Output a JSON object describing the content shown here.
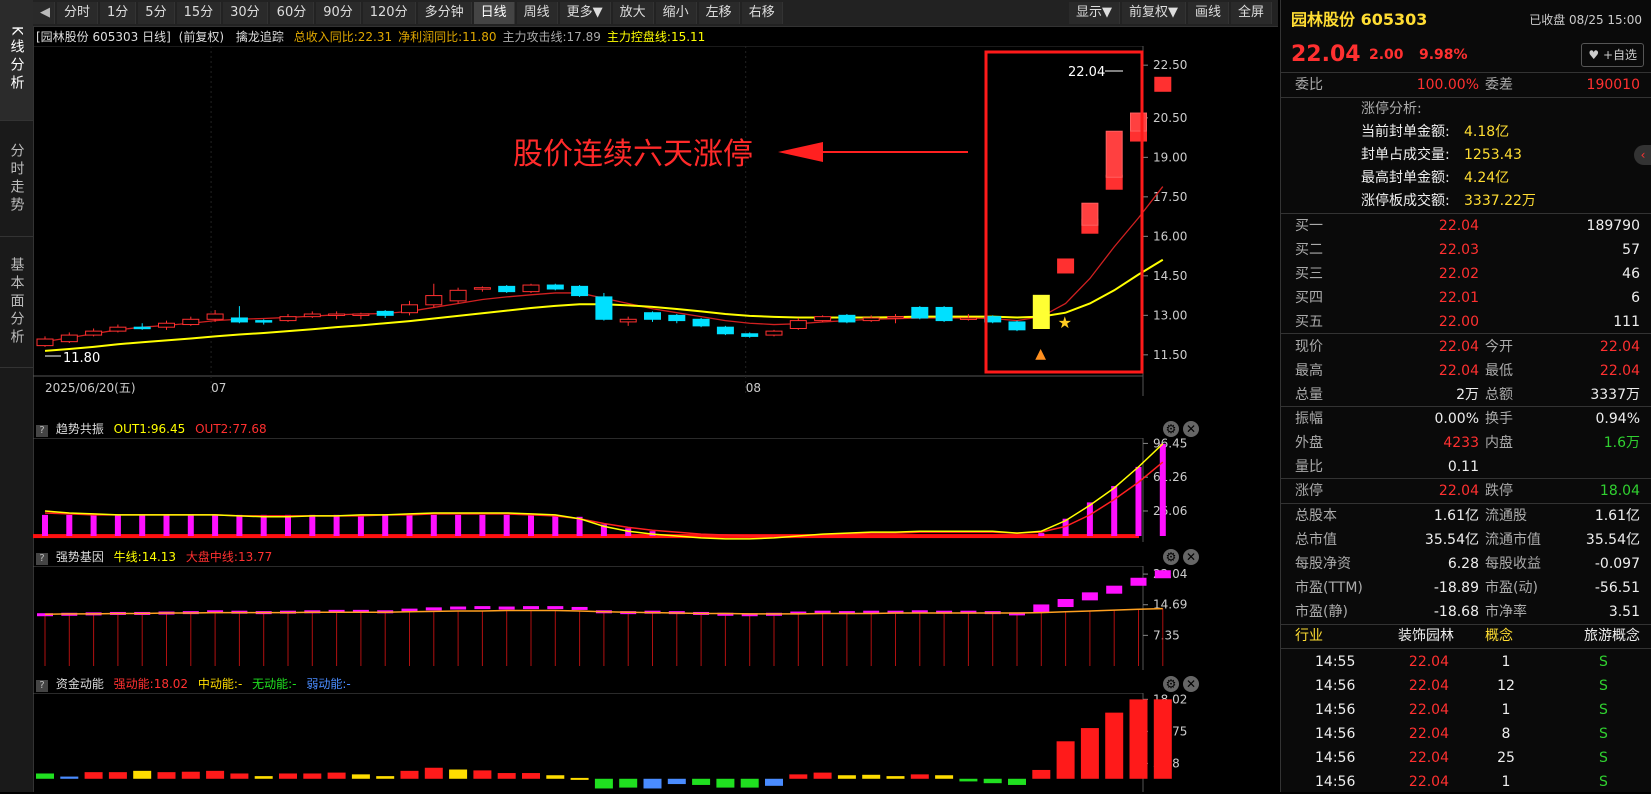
{
  "rail": {
    "tabs": [
      {
        "label": "K线分析",
        "active": true
      },
      {
        "label": "分时走势",
        "active": false
      },
      {
        "label": "基本面分析",
        "active": false
      }
    ]
  },
  "toolbar": {
    "back_icon": "back-arrow-icon",
    "buttons": [
      "分时",
      "1分",
      "5分",
      "15分",
      "30分",
      "60分",
      "90分",
      "120分",
      "多分钟",
      "日线",
      "周线",
      "更多▼",
      "放大",
      "缩小",
      "左移",
      "右移"
    ],
    "active": "日线",
    "right_buttons": [
      "显示▼",
      "前复权▼",
      "画线",
      "全屏"
    ]
  },
  "main_chart": {
    "header_prefix": "[园林股份 605303 日线]",
    "header_adjust": "(前复权)",
    "header_indicator": "擒龙追踪",
    "stats": [
      {
        "label": "总收入同比:22.31",
        "color": "#e0a800"
      },
      {
        "label": "净利润同比:11.80",
        "color": "#e0a800"
      },
      {
        "label": "主力攻击线:17.89",
        "color": "#aaaaaa"
      },
      {
        "label": "主力控盘线:15.11",
        "color": "#ffff00"
      }
    ],
    "annotation": "股价连续六天涨停",
    "price_label_top": "22.04",
    "price_label_low": "11.80",
    "date_first": "2025/06/20(五)",
    "month_labels": [
      "07",
      "08"
    ],
    "y_ticks": [
      22.5,
      20.5,
      19.0,
      17.5,
      16.0,
      14.5,
      13.0,
      11.5
    ],
    "y_tick_labels": [
      "22.50",
      "20.50",
      "19.00",
      "17.50",
      "16.00",
      "14.50",
      "13.00",
      "11.50"
    ]
  },
  "chart_data": [
    {
      "type": "candlestick",
      "title": "园林股份 605303 日线",
      "ylim": [
        11.0,
        23.0
      ],
      "x_labels": {
        "first": "2025/06/20(五)",
        "month_07_index": 7,
        "month_08_index": 29
      },
      "candles": [
        {
          "o": 11.85,
          "c": 12.1,
          "h": 12.2,
          "l": 11.8
        },
        {
          "o": 12.0,
          "c": 12.25,
          "h": 12.35,
          "l": 11.95
        },
        {
          "o": 12.25,
          "c": 12.4,
          "h": 12.5,
          "l": 12.2
        },
        {
          "o": 12.4,
          "c": 12.55,
          "h": 12.65,
          "l": 12.35
        },
        {
          "o": 12.55,
          "c": 12.5,
          "h": 12.7,
          "l": 12.45
        },
        {
          "o": 12.55,
          "c": 12.7,
          "h": 12.8,
          "l": 12.45
        },
        {
          "o": 12.65,
          "c": 12.85,
          "h": 12.95,
          "l": 12.6
        },
        {
          "o": 12.85,
          "c": 13.05,
          "h": 13.2,
          "l": 12.75
        },
        {
          "o": 12.9,
          "c": 12.75,
          "h": 13.35,
          "l": 12.7
        },
        {
          "o": 12.8,
          "c": 12.75,
          "h": 12.85,
          "l": 12.65
        },
        {
          "o": 12.8,
          "c": 12.95,
          "h": 13.05,
          "l": 12.75
        },
        {
          "o": 12.95,
          "c": 13.05,
          "h": 13.15,
          "l": 12.9
        },
        {
          "o": 13.0,
          "c": 13.05,
          "h": 13.15,
          "l": 12.85
        },
        {
          "o": 13.0,
          "c": 13.05,
          "h": 13.1,
          "l": 12.85
        },
        {
          "o": 13.15,
          "c": 13.0,
          "h": 13.2,
          "l": 12.9
        },
        {
          "o": 13.1,
          "c": 13.4,
          "h": 13.55,
          "l": 13.0
        },
        {
          "o": 13.4,
          "c": 13.75,
          "h": 14.2,
          "l": 13.3
        },
        {
          "o": 13.55,
          "c": 13.95,
          "h": 14.05,
          "l": 13.45
        },
        {
          "o": 14.0,
          "c": 14.05,
          "h": 14.1,
          "l": 13.9
        },
        {
          "o": 14.1,
          "c": 13.9,
          "h": 14.15,
          "l": 13.85
        },
        {
          "o": 13.9,
          "c": 14.15,
          "h": 14.2,
          "l": 13.85
        },
        {
          "o": 14.15,
          "c": 14.0,
          "h": 14.2,
          "l": 13.95
        },
        {
          "o": 14.1,
          "c": 13.75,
          "h": 14.15,
          "l": 13.7
        },
        {
          "o": 13.7,
          "c": 12.85,
          "h": 13.85,
          "l": 12.8
        },
        {
          "o": 12.75,
          "c": 12.85,
          "h": 12.95,
          "l": 12.6
        },
        {
          "o": 13.1,
          "c": 12.85,
          "h": 13.15,
          "l": 12.75
        },
        {
          "o": 13.0,
          "c": 12.8,
          "h": 13.05,
          "l": 12.7
        },
        {
          "o": 12.85,
          "c": 12.6,
          "h": 12.9,
          "l": 12.55
        },
        {
          "o": 12.55,
          "c": 12.3,
          "h": 12.6,
          "l": 12.25
        },
        {
          "o": 12.3,
          "c": 12.2,
          "h": 12.35,
          "l": 12.15
        },
        {
          "o": 12.25,
          "c": 12.4,
          "h": 12.45,
          "l": 12.2
        },
        {
          "o": 12.5,
          "c": 12.8,
          "h": 12.9,
          "l": 12.45
        },
        {
          "o": 12.8,
          "c": 12.95,
          "h": 13.0,
          "l": 12.75
        },
        {
          "o": 13.0,
          "c": 12.75,
          "h": 13.05,
          "l": 12.7
        },
        {
          "o": 12.8,
          "c": 12.9,
          "h": 13.0,
          "l": 12.75
        },
        {
          "o": 12.9,
          "c": 12.95,
          "h": 13.05,
          "l": 12.7
        },
        {
          "o": 13.3,
          "c": 12.9,
          "h": 13.35,
          "l": 12.85
        },
        {
          "o": 13.3,
          "c": 12.8,
          "h": 13.35,
          "l": 12.75
        },
        {
          "o": 12.85,
          "c": 12.9,
          "h": 13.05,
          "l": 12.8
        },
        {
          "o": 12.95,
          "c": 12.75,
          "h": 13.0,
          "l": 12.7
        },
        {
          "o": 12.75,
          "c": 12.45,
          "h": 12.8,
          "l": 12.4
        },
        {
          "o": 12.5,
          "c": 13.76,
          "h": 13.76,
          "l": 12.5
        },
        {
          "o": 15.14,
          "c": 15.14,
          "h": 15.14,
          "l": 15.14
        },
        {
          "o": 16.65,
          "c": 16.65,
          "h": 16.65,
          "l": 16.65
        },
        {
          "o": 18.32,
          "c": 18.32,
          "h": 18.32,
          "l": 18.32
        },
        {
          "o": 20.15,
          "c": 20.15,
          "h": 20.15,
          "l": 20.15
        },
        {
          "o": 22.04,
          "c": 22.04,
          "h": 22.04,
          "l": 22.04
        }
      ],
      "ma_attack": [
        12.0,
        12.15,
        12.3,
        12.45,
        12.55,
        12.62,
        12.7,
        12.8,
        12.85,
        12.88,
        12.92,
        12.97,
        13.02,
        13.05,
        13.07,
        13.15,
        13.3,
        13.45,
        13.6,
        13.7,
        13.78,
        13.85,
        13.85,
        13.65,
        13.45,
        13.25,
        13.1,
        12.95,
        12.8,
        12.7,
        12.65,
        12.68,
        12.75,
        12.8,
        12.85,
        12.87,
        12.9,
        12.9,
        12.9,
        12.88,
        12.8,
        12.95,
        13.45,
        14.4,
        15.6,
        16.7,
        17.89
      ],
      "ma_control": [
        11.65,
        11.72,
        11.8,
        11.9,
        11.98,
        12.05,
        12.12,
        12.2,
        12.27,
        12.33,
        12.4,
        12.47,
        12.55,
        12.62,
        12.7,
        12.78,
        12.88,
        12.98,
        13.08,
        13.18,
        13.28,
        13.36,
        13.42,
        13.42,
        13.38,
        13.32,
        13.24,
        13.15,
        13.05,
        12.98,
        12.94,
        12.92,
        12.92,
        12.92,
        12.92,
        12.93,
        12.95,
        12.95,
        12.95,
        12.95,
        12.92,
        12.95,
        13.1,
        13.45,
        13.95,
        14.55,
        15.11
      ]
    },
    {
      "type": "bar",
      "title": "趋势共振",
      "series": [
        {
          "name": "OUT1",
          "value_label": "OUT1:96.45",
          "color": "#ffff00"
        },
        {
          "name": "OUT2",
          "value_label": "OUT2:77.68",
          "color": "#ff2020"
        }
      ],
      "y_ticks": [
        96.45,
        61.26,
        26.06
      ],
      "y_tick_labels": [
        "96.45",
        "61.26",
        "26.06"
      ],
      "ylim": [
        0,
        100
      ],
      "bars": [
        22,
        22,
        22,
        22,
        22,
        22,
        22,
        22,
        22,
        22,
        22,
        22,
        22,
        22,
        22,
        22,
        22,
        22,
        22,
        22,
        22,
        22,
        20,
        12,
        8,
        5,
        0,
        0,
        0,
        0,
        0,
        0,
        0,
        0,
        0,
        0,
        0,
        0,
        0,
        0,
        0,
        3,
        18,
        35,
        52,
        72,
        96
      ],
      "out1": [
        26,
        24,
        23,
        22,
        22,
        22,
        22,
        22,
        21,
        20,
        20,
        21,
        21,
        22,
        22,
        23,
        24,
        24,
        24,
        24,
        23,
        22,
        18,
        10,
        5,
        2,
        0,
        -2,
        -3,
        -3,
        -2,
        0,
        2,
        3,
        4,
        4,
        5,
        5,
        5,
        5,
        3,
        5,
        16,
        32,
        50,
        72,
        96
      ],
      "out2": [
        24,
        23,
        22,
        22,
        22,
        22,
        22,
        22,
        21,
        21,
        21,
        21,
        21,
        21,
        22,
        22,
        23,
        23,
        23,
        23,
        22,
        21,
        18,
        13,
        9,
        6,
        4,
        2,
        1,
        0,
        0,
        0,
        1,
        2,
        3,
        3,
        4,
        4,
        4,
        4,
        3,
        4,
        10,
        22,
        38,
        56,
        77
      ]
    },
    {
      "type": "bar",
      "title": "强势基因",
      "series": [
        {
          "name": "牛线",
          "value_label": "牛线:14.13",
          "color": "#ffff00"
        },
        {
          "name": "大盘中线",
          "value_label": "大盘中线:13.77",
          "color": "#ff2020"
        }
      ],
      "y_ticks": [
        22.04,
        14.69,
        7.35
      ],
      "y_tick_labels": [
        "22.04",
        "14.69",
        "7.35"
      ],
      "ylim": [
        0,
        23.5
      ],
      "levels": [
        12.3,
        12.4,
        12.5,
        12.6,
        12.6,
        12.7,
        12.8,
        13.0,
        12.9,
        12.8,
        12.9,
        13.0,
        13.1,
        13.1,
        13.0,
        13.4,
        13.7,
        13.9,
        14.0,
        13.9,
        14.0,
        14.0,
        13.8,
        13.0,
        12.8,
        12.9,
        12.8,
        12.6,
        12.4,
        12.3,
        12.4,
        12.7,
        12.9,
        12.8,
        12.9,
        12.9,
        13.0,
        12.9,
        12.9,
        12.8,
        12.5,
        13.8,
        15.1,
        16.7,
        18.3,
        20.2,
        22.0
      ],
      "dadpan": [
        12.4,
        12.5,
        12.5,
        12.6,
        12.6,
        12.7,
        12.7,
        12.8,
        12.8,
        12.8,
        12.8,
        12.9,
        12.9,
        12.9,
        12.9,
        13.0,
        13.1,
        13.2,
        13.2,
        13.3,
        13.3,
        13.3,
        13.2,
        13.0,
        12.9,
        12.8,
        12.7,
        12.6,
        12.6,
        12.5,
        12.5,
        12.5,
        12.6,
        12.6,
        12.6,
        12.7,
        12.7,
        12.7,
        12.7,
        12.7,
        12.7,
        12.8,
        13.0,
        13.2,
        13.4,
        13.6,
        13.77
      ]
    },
    {
      "type": "bar",
      "title": "资金动能",
      "series": [
        {
          "name": "强动能",
          "value_label": "强动能:18.02",
          "color": "#ff2020"
        },
        {
          "name": "中动能",
          "value_label": "中动能:-",
          "color": "#ffdd00"
        },
        {
          "name": "无动能",
          "value_label": "无动能:-",
          "color": "#20e020"
        },
        {
          "name": "弱动能",
          "value_label": "弱动能:-",
          "color": "#4a8cff"
        }
      ],
      "y_ticks": [
        18.02,
        10.75,
        3.48
      ],
      "y_tick_labels": [
        "18.02",
        "10.75",
        "3.48"
      ],
      "ylim": [
        -3,
        19
      ],
      "values": [
        {
          "v": 1.2,
          "c": "g"
        },
        {
          "v": 0.5,
          "c": "b"
        },
        {
          "v": 1.5,
          "c": "r"
        },
        {
          "v": 1.5,
          "c": "r"
        },
        {
          "v": 1.8,
          "c": "y"
        },
        {
          "v": 1.5,
          "c": "r"
        },
        {
          "v": 1.6,
          "c": "r"
        },
        {
          "v": 1.8,
          "c": "r"
        },
        {
          "v": 1.2,
          "c": "r"
        },
        {
          "v": 0.6,
          "c": "y"
        },
        {
          "v": 1.2,
          "c": "r"
        },
        {
          "v": 1.2,
          "c": "r"
        },
        {
          "v": 1.4,
          "c": "r"
        },
        {
          "v": 1.0,
          "c": "y"
        },
        {
          "v": 0.6,
          "c": "y"
        },
        {
          "v": 1.8,
          "c": "r"
        },
        {
          "v": 2.5,
          "c": "r"
        },
        {
          "v": 2.1,
          "c": "y"
        },
        {
          "v": 1.9,
          "c": "r"
        },
        {
          "v": 1.3,
          "c": "r"
        },
        {
          "v": 1.3,
          "c": "r"
        },
        {
          "v": 0.8,
          "c": "y"
        },
        {
          "v": 0.2,
          "c": "y"
        },
        {
          "v": -2.2,
          "c": "g"
        },
        {
          "v": -2.0,
          "c": "g"
        },
        {
          "v": -2.2,
          "c": "b"
        },
        {
          "v": -1.2,
          "c": "b"
        },
        {
          "v": -1.4,
          "c": "g"
        },
        {
          "v": -2.0,
          "c": "g"
        },
        {
          "v": -2.0,
          "c": "g"
        },
        {
          "v": -1.6,
          "c": "b"
        },
        {
          "v": 1.0,
          "c": "r"
        },
        {
          "v": 1.4,
          "c": "r"
        },
        {
          "v": 0.8,
          "c": "y"
        },
        {
          "v": 0.9,
          "c": "y"
        },
        {
          "v": 0.6,
          "c": "y"
        },
        {
          "v": 1.0,
          "c": "r"
        },
        {
          "v": 0.8,
          "c": "y"
        },
        {
          "v": -0.6,
          "c": "g"
        },
        {
          "v": -1.0,
          "c": "g"
        },
        {
          "v": -1.4,
          "c": "g"
        },
        {
          "v": 2.0,
          "c": "r"
        },
        {
          "v": 8.5,
          "c": "r"
        },
        {
          "v": 11.5,
          "c": "r"
        },
        {
          "v": 15.0,
          "c": "r"
        },
        {
          "v": 18.0,
          "c": "r"
        },
        {
          "v": 18.02,
          "c": "r"
        }
      ]
    }
  ],
  "right_panel": {
    "stock_name": "园林股份 605303",
    "status": "已收盘 08/25 15:00",
    "price": "22.04",
    "change": "2.00",
    "change_pct": "9.98%",
    "watch_button": "+自选",
    "weibi_label": "委比",
    "weibi_value": "100.00%",
    "weicha_label": "委差",
    "weicha_value": "190010",
    "limit_title": "涨停分析:",
    "limit_rows": [
      {
        "label": "当前封单金额:",
        "value": "4.18亿"
      },
      {
        "label": "封单占成交量:",
        "value": "1253.43"
      },
      {
        "label": "最高封单金额:",
        "value": "4.24亿"
      },
      {
        "label": "涨停板成交额:",
        "value": "3337.22万"
      }
    ],
    "bids": [
      {
        "label": "买一",
        "price": "22.04",
        "vol": "189790"
      },
      {
        "label": "买二",
        "price": "22.03",
        "vol": "57"
      },
      {
        "label": "买三",
        "price": "22.02",
        "vol": "46"
      },
      {
        "label": "买四",
        "price": "22.01",
        "vol": "6"
      },
      {
        "label": "买五",
        "price": "22.00",
        "vol": "111"
      }
    ],
    "quote_rows": [
      {
        "l1": "现价",
        "v1": "22.04",
        "c1": "red",
        "l2": "今开",
        "v2": "22.04",
        "c2": "red"
      },
      {
        "l1": "最高",
        "v1": "22.04",
        "c1": "red",
        "l2": "最低",
        "v2": "22.04",
        "c2": "red"
      },
      {
        "l1": "总量",
        "v1": "2万",
        "c1": "white",
        "l2": "总额",
        "v2": "3337万",
        "c2": "white"
      }
    ],
    "quote_rows2": [
      {
        "l1": "振幅",
        "v1": "0.00%",
        "c1": "white",
        "l2": "换手",
        "v2": "0.94%",
        "c2": "white"
      },
      {
        "l1": "外盘",
        "v1": "4233",
        "c1": "red",
        "l2": "内盘",
        "v2": "1.6万",
        "c2": "green"
      },
      {
        "l1": "量比",
        "v1": "0.11",
        "c1": "white",
        "l2": "",
        "v2": "",
        "c2": "white"
      }
    ],
    "limit_row": {
      "l1": "涨停",
      "v1": "22.04",
      "l2": "跌停",
      "v2": "18.04"
    },
    "fundamentals": [
      {
        "l1": "总股本",
        "v1": "1.61亿",
        "l2": "流通股",
        "v2": "1.61亿"
      },
      {
        "l1": "总市值",
        "v1": "35.54亿",
        "l2": "流通市值",
        "v2": "35.54亿"
      },
      {
        "l1": "每股净资",
        "v1": "6.28",
        "l2": "每股收益",
        "v2": "-0.097"
      },
      {
        "l1": "市盈(TTM)",
        "v1": "-18.89",
        "l2": "市盈(动)",
        "v2": "-56.51"
      },
      {
        "l1": "市盈(静)",
        "v1": "-18.68",
        "l2": "市净率",
        "v2": "3.51"
      }
    ],
    "industry_label": "行业",
    "industry_value": "装饰园林",
    "concept_label": "概念",
    "concept_value": "旅游概念",
    "ticks": [
      {
        "time": "14:55",
        "price": "22.04",
        "vol": "1",
        "side": "S"
      },
      {
        "time": "14:56",
        "price": "22.04",
        "vol": "12",
        "side": "S"
      },
      {
        "time": "14:56",
        "price": "22.04",
        "vol": "1",
        "side": "S"
      },
      {
        "time": "14:56",
        "price": "22.04",
        "vol": "8",
        "side": "S"
      },
      {
        "time": "14:56",
        "price": "22.04",
        "vol": "25",
        "side": "S"
      },
      {
        "time": "14:56",
        "price": "22.04",
        "vol": "1",
        "side": "S"
      }
    ],
    "colors": {
      "up": "#ff3030",
      "down": "#30d030",
      "label": "#ffdd33"
    }
  }
}
